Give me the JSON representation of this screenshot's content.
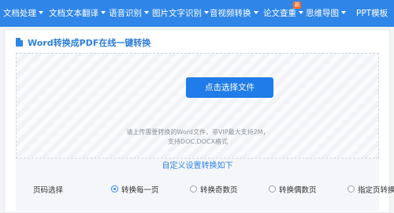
{
  "nav": {
    "items": [
      {
        "label": "文档处理"
      },
      {
        "label": "文档文本翻译"
      },
      {
        "label": "语音识别"
      },
      {
        "label": "图片文字识别"
      },
      {
        "label": "音视频转换"
      },
      {
        "label": "论文查重"
      },
      {
        "label": "思维导图"
      },
      {
        "label": "PPT模板"
      }
    ],
    "new_badge": "新",
    "background_color": "#2f86e8"
  },
  "panel": {
    "title": "Word转换成PDF在线一键转换",
    "title_icon": "document-icon"
  },
  "upload": {
    "button_label": "点击选择文件",
    "hint_line1": "请上传需要转换的Word文件，非VIP最大支持2M，",
    "hint_line2": "支持DOC,DOCX格式"
  },
  "settings": {
    "title": "自定义设置转换如下",
    "page_select_label": "页码选择",
    "options": [
      {
        "label": "转换每一页",
        "checked": true
      },
      {
        "label": "转换奇数页",
        "checked": false
      },
      {
        "label": "转换偶数页",
        "checked": false
      },
      {
        "label": "指定页转换",
        "checked": false
      }
    ]
  },
  "colors": {
    "accent": "#1f7ce8",
    "title_text": "#2f7fd9"
  }
}
